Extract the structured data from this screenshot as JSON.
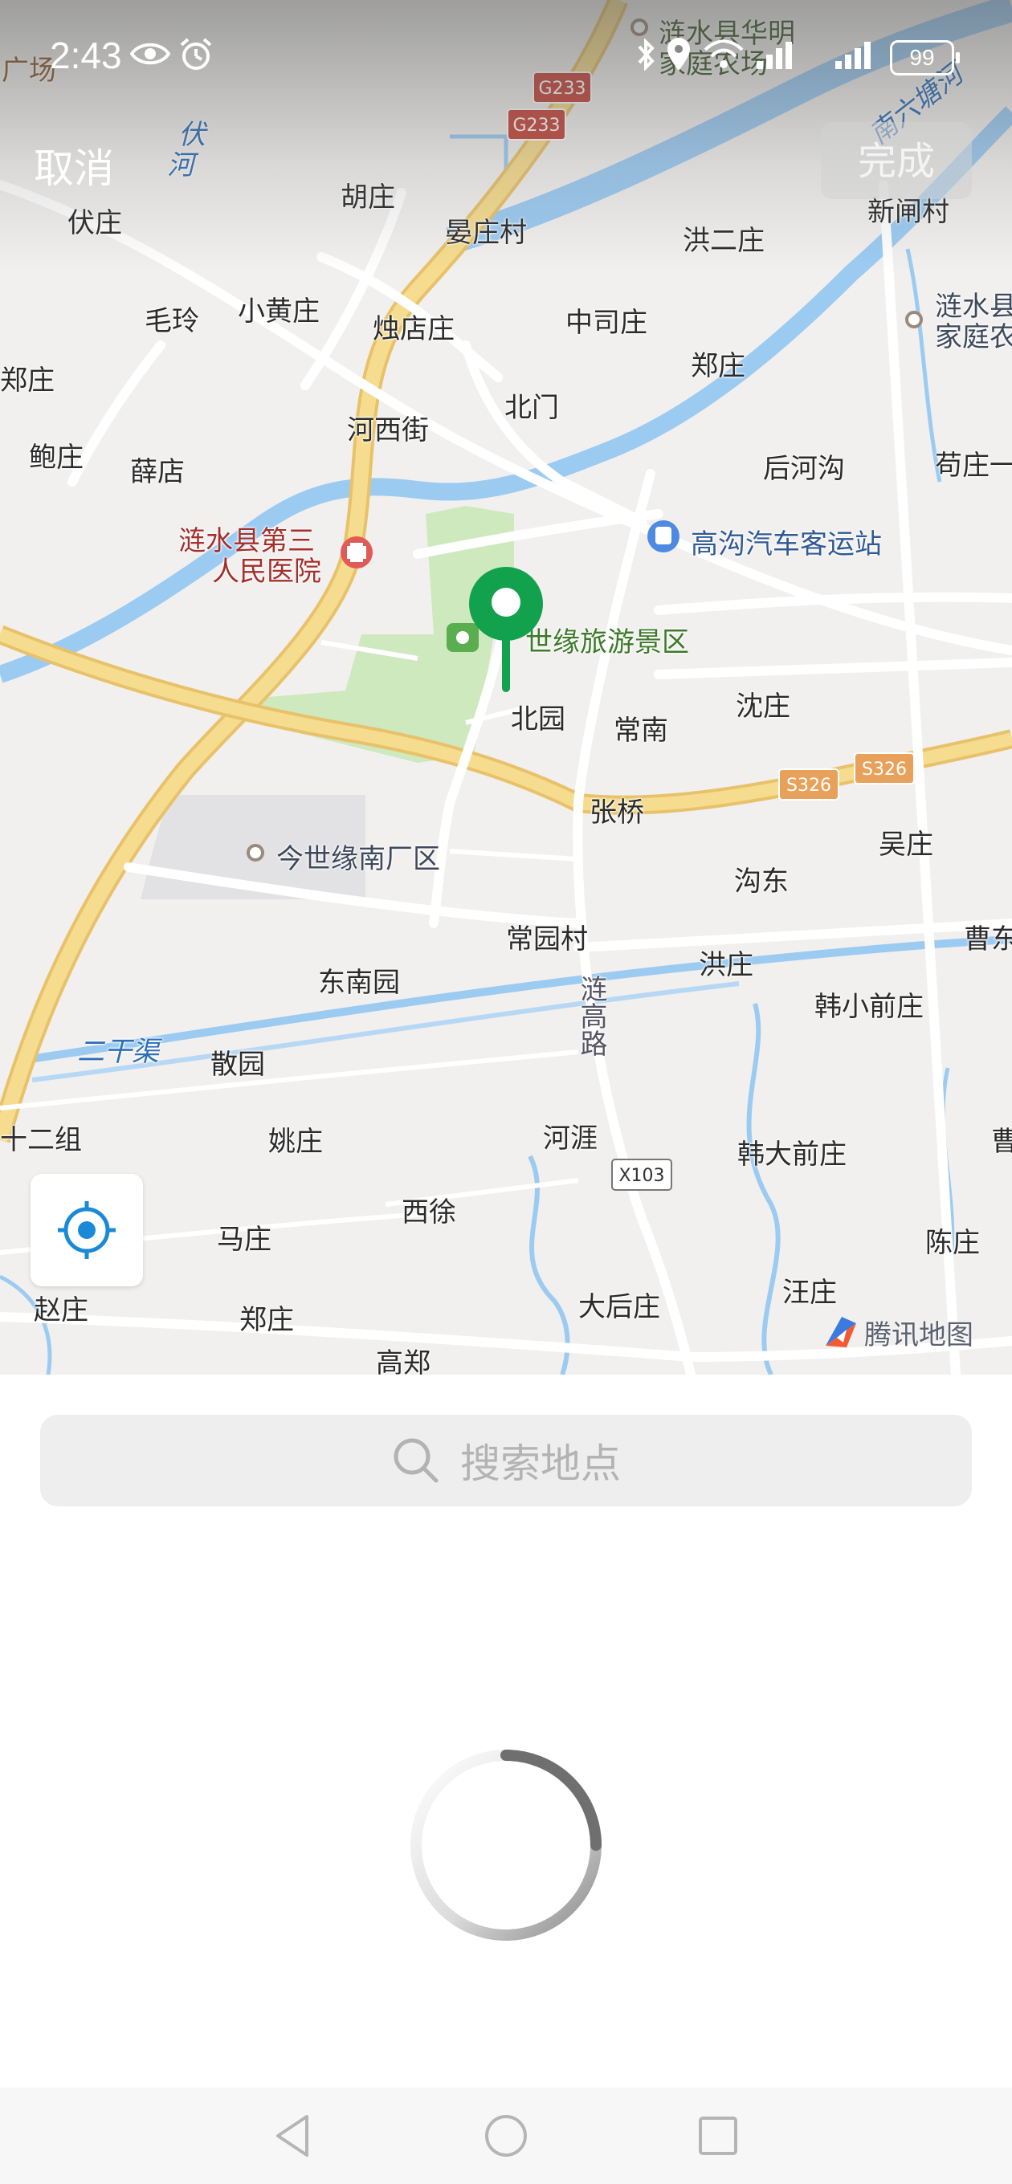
{
  "status_bar": {
    "time": "2:43",
    "battery": "99"
  },
  "header": {
    "cancel_label": "取消",
    "done_label": "完成"
  },
  "map": {
    "provider_label": "腾讯地图",
    "marker_label": "世缘旅游景区",
    "road_shields": [
      "G233",
      "G233",
      "S326",
      "S326",
      "X103"
    ],
    "labels": {
      "guangchang": "广场",
      "huaming_1": "涟水县华明",
      "huaming_2": "家庭农场",
      "fuhe_1": "伏",
      "fuhe_2": "河",
      "nanliutanghe": "南六塘河",
      "huzhuang": "胡庄",
      "fuzhuang": "伏庄",
      "yanzhuangcun": "晏庄村",
      "hongerzhuang": "洪二庄",
      "xinzhacun": "新闸村",
      "lianshui_farm_1": "涟水县",
      "lianshui_farm_2": "家庭农",
      "maoling": "毛玲",
      "xiaohuangzhuang": "小黄庄",
      "zhudianzhuang": "烛店庄",
      "zhongsizhuang": "中司庄",
      "zhengzhuang_ne": "郑庄",
      "zhengzhuang_w": "郑庄",
      "beimen": "北门",
      "hexijie": "河西街",
      "baozhuang": "鲍庄",
      "xuedian": "薛店",
      "houhegou": "后河沟",
      "gouzhuang1": "苟庄一",
      "hospital_1": "涟水县第三",
      "hospital_2": "人民医院",
      "bus_station": "高沟汽车客运站",
      "beiyuan": "北园",
      "changnan": "常南",
      "shenzhuang": "沈庄",
      "zhangqiao": "张桥",
      "wuzhuang": "吴庄",
      "factory": "今世缘南厂区",
      "goudong": "沟东",
      "changyuancun": "常园村",
      "caodong": "曹东",
      "dongnanyuan": "东南园",
      "hongzhuang": "洪庄",
      "hanxiaoqianzhuang": "韩小前庄",
      "lianshui_road": "涟高路",
      "erganqu": "二干渠",
      "sanyuan": "散园",
      "shierzu": "十二组",
      "yaozhuang": "姚庄",
      "heya": "河涯",
      "handaqianzhuang": "韩大前庄",
      "cao": "曹",
      "xixu": "西徐",
      "mazhuang": "马庄",
      "chenzhuang": "陈庄",
      "zhaozhuang": "赵庄",
      "zhengzhuang_s": "郑庄",
      "dahouzhuang": "大后庄",
      "wangzhuang": "汪庄",
      "gaozheng": "高郑"
    }
  },
  "search": {
    "placeholder": "搜索地点"
  },
  "colors": {
    "marker_green": "#12a14c",
    "river_blue": "#9ccbf2",
    "highway_yellow": "#f3d27a",
    "park_green": "#cfe9bf",
    "map_bg": "#f1f0ee",
    "search_bg": "#eeeeee",
    "locate_blue": "#1a8ad6"
  },
  "icons": {
    "locate": "crosshair-locate-icon",
    "search": "search-icon",
    "spinner": "loading-spinner-icon"
  }
}
